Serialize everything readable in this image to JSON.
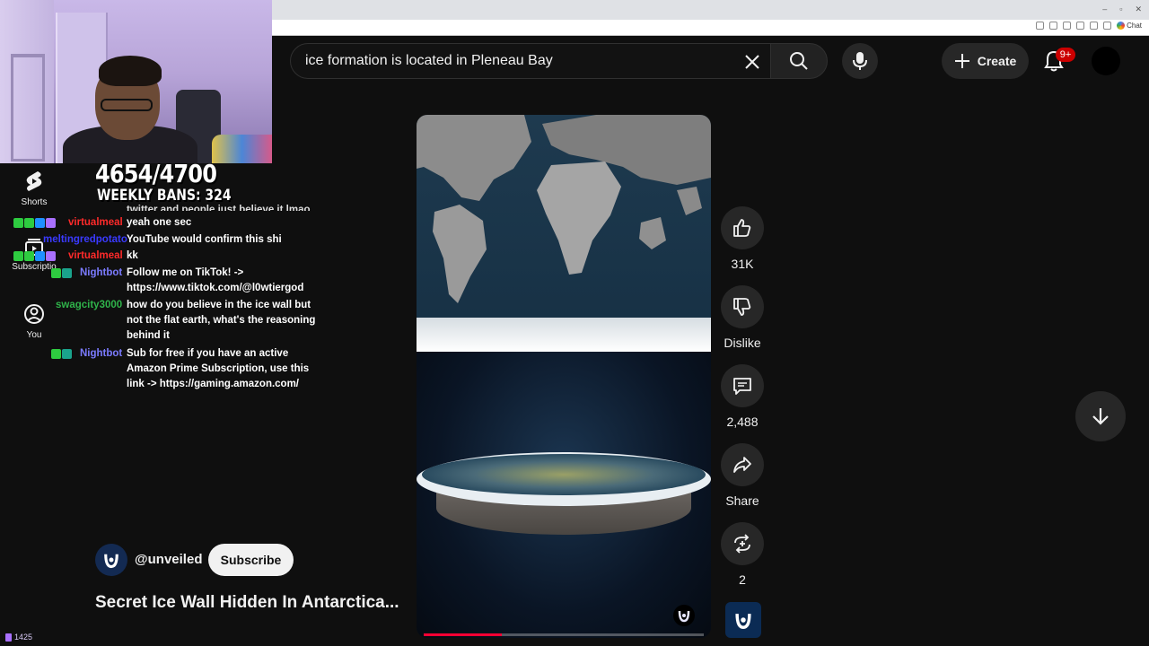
{
  "search": {
    "query": "ice formation is located in Pleneau Bay"
  },
  "header": {
    "create_label": "Create",
    "notification_badge": "9+"
  },
  "browser": {
    "chat_label": "Chat"
  },
  "rail": {
    "shorts": "Shorts",
    "subscriptions": "Subscriptio",
    "you": "You"
  },
  "overlay": {
    "counter": "4654/4700",
    "weekly_bans": "WEEKLY BANS: 324",
    "viewer_count": "1425"
  },
  "chat": {
    "cut_line": "twitter and people just believe it lmao",
    "messages": [
      {
        "user": "virtualmeal",
        "color": "#ff2a2a",
        "lines": [
          "yeah one sec"
        ]
      },
      {
        "user": "meltingredpotato",
        "color": "#3a3aff",
        "lines": [
          "YouTube would confirm this shi"
        ]
      },
      {
        "user": "virtualmeal",
        "color": "#ff2a2a",
        "lines": [
          "kk"
        ]
      },
      {
        "user": "Nightbot",
        "color": "#7b7bff",
        "lines": [
          "Follow me on TikTok! ->",
          "https://www.tiktok.com/@l0wtiergod"
        ]
      },
      {
        "user": "swagcity3000",
        "color": "#2fb34a",
        "lines": [
          "how do you believe in the ice wall but",
          "not the flat earth, what's the reasoning",
          "behind it"
        ]
      },
      {
        "user": "Nightbot",
        "color": "#7b7bff",
        "lines": [
          "Sub for free if you have an active",
          "Amazon Prime Subscription, use this",
          "link -> https://gaming.amazon.com/"
        ]
      }
    ]
  },
  "video": {
    "progress": 0.28
  },
  "actions": {
    "likes": "31K",
    "dislike": "Dislike",
    "comments": "2,488",
    "share": "Share",
    "remix": "2"
  },
  "channel": {
    "handle": "@unveiled",
    "subscribe_label": "Subscribe",
    "title": "Secret Ice Wall Hidden In Antarctica..."
  },
  "colors": {
    "accent": "#ff0033",
    "background": "#0f0f0f",
    "button": "#272727"
  }
}
